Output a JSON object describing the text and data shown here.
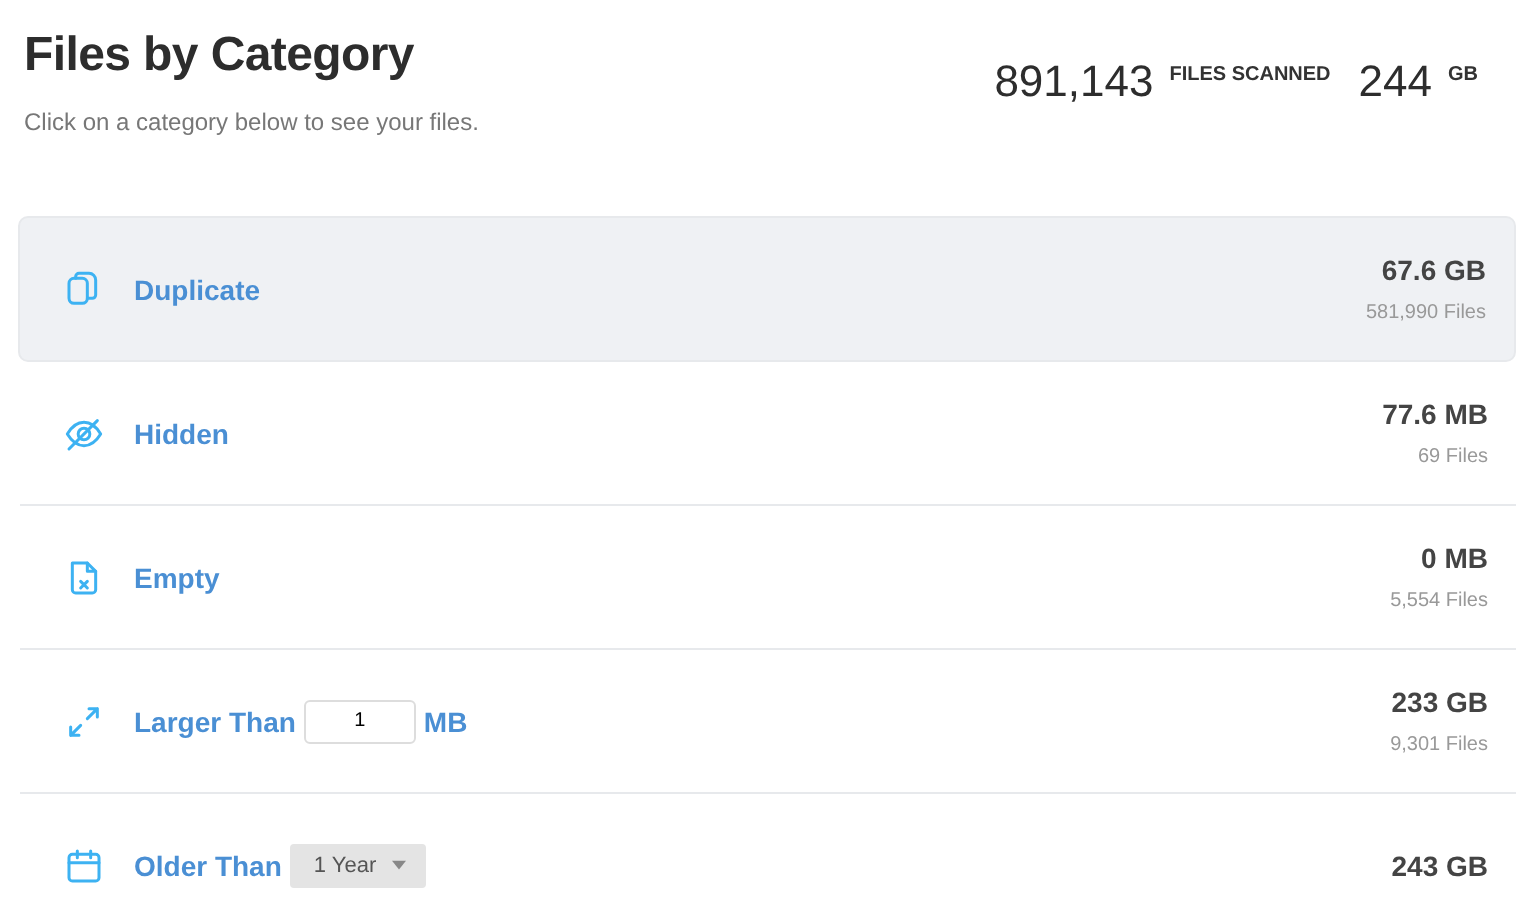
{
  "header": {
    "title": "Files by Category",
    "subtitle": "Click on a category below to see your files.",
    "stats": [
      {
        "value": "891,143",
        "unit": "FILES SCANNED"
      },
      {
        "value": "244",
        "unit": "GB"
      }
    ]
  },
  "categories": [
    {
      "kind": "plain",
      "label": "Duplicate",
      "selected": true,
      "size": "67.6 GB",
      "files": "581,990 Files"
    },
    {
      "kind": "plain",
      "label": "Hidden",
      "selected": false,
      "size": "77.6 MB",
      "files": "69 Files"
    },
    {
      "kind": "plain",
      "label": "Empty",
      "selected": false,
      "size": "0 MB",
      "files": "5,554 Files"
    },
    {
      "kind": "number",
      "label": "Larger Than",
      "selected": false,
      "value": "1",
      "unit": "MB",
      "size": "233 GB",
      "files": "9,301 Files"
    },
    {
      "kind": "dropdown",
      "label": "Older Than",
      "selected": false,
      "value": "1 Year",
      "size": "243 GB"
    }
  ]
}
